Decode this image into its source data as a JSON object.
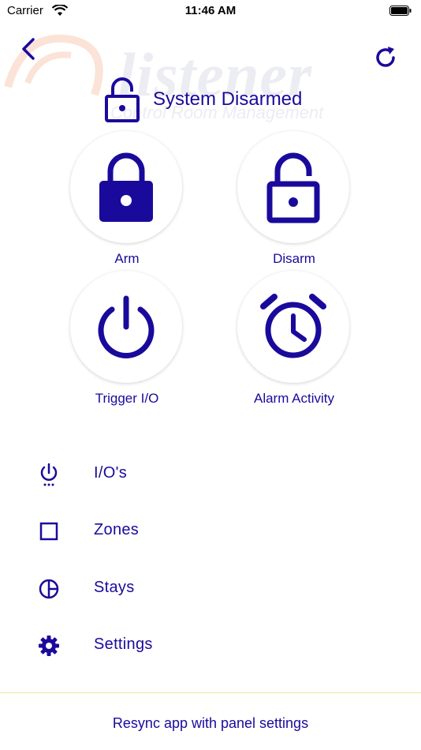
{
  "status_bar": {
    "carrier": "Carrier",
    "time": "11:46 AM"
  },
  "watermark": {
    "brand": "listener",
    "tagline": "Control Room Management"
  },
  "header": {
    "status_text": "System Disarmed"
  },
  "actions": [
    {
      "label": "Arm",
      "icon": "lock-closed-icon"
    },
    {
      "label": "Disarm",
      "icon": "lock-open-icon"
    },
    {
      "label": "Trigger I/O",
      "icon": "power-icon"
    },
    {
      "label": "Alarm Activity",
      "icon": "alarm-clock-icon"
    }
  ],
  "menu": [
    {
      "label": "I/O's",
      "icon": "power-dots-icon"
    },
    {
      "label": "Zones",
      "icon": "square-icon"
    },
    {
      "label": "Stays",
      "icon": "pie-icon"
    },
    {
      "label": "Settings",
      "icon": "gear-icon"
    }
  ],
  "footer": {
    "resync_label": "Resync app with panel settings"
  },
  "colors": {
    "primary": "#1a0a9c",
    "divider": "#f2e7a3"
  }
}
